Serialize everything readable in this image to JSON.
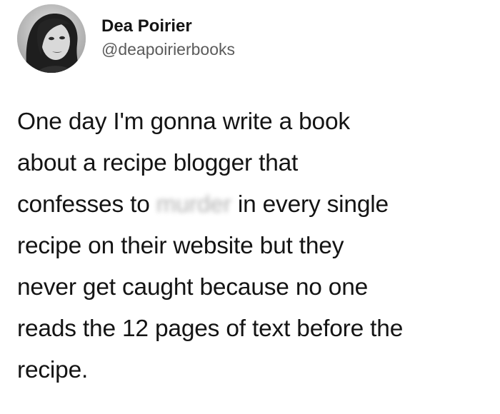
{
  "tweet": {
    "author": {
      "display_name": "Dea Poirier",
      "handle": "@deapoirierbooks"
    },
    "text_lines": [
      "One day I'm gonna write a book",
      "about a recipe blogger that",
      "confesses to ",
      " in every single",
      "recipe on their website but they",
      "never get caught because no one",
      "reads the 12 pages of text before the",
      "recipe."
    ],
    "censored_word": "murder"
  }
}
